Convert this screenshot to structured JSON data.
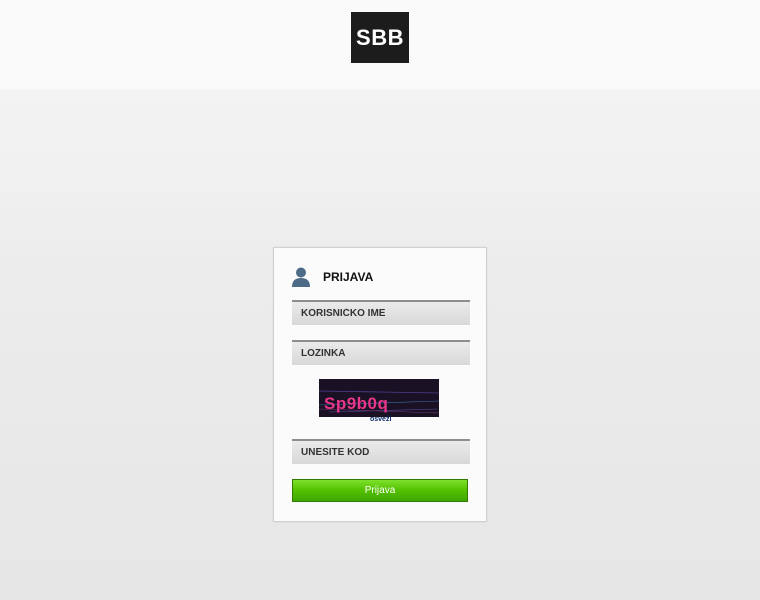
{
  "brand": {
    "logo_text": "SBB"
  },
  "login": {
    "title": "PRIJAVA",
    "username_placeholder": "KORISNIČKO IME",
    "password_placeholder": "LOZINKA",
    "captcha_text": "Sp9b0q",
    "refresh_label": "osveži",
    "code_placeholder": "UNESITE KOD",
    "submit_label": "Prijava"
  },
  "colors": {
    "logo_background": "#1c1c1c",
    "button_green": "#53c000",
    "captcha_text": "#e8368a"
  },
  "icons": {
    "user": "user-icon"
  }
}
